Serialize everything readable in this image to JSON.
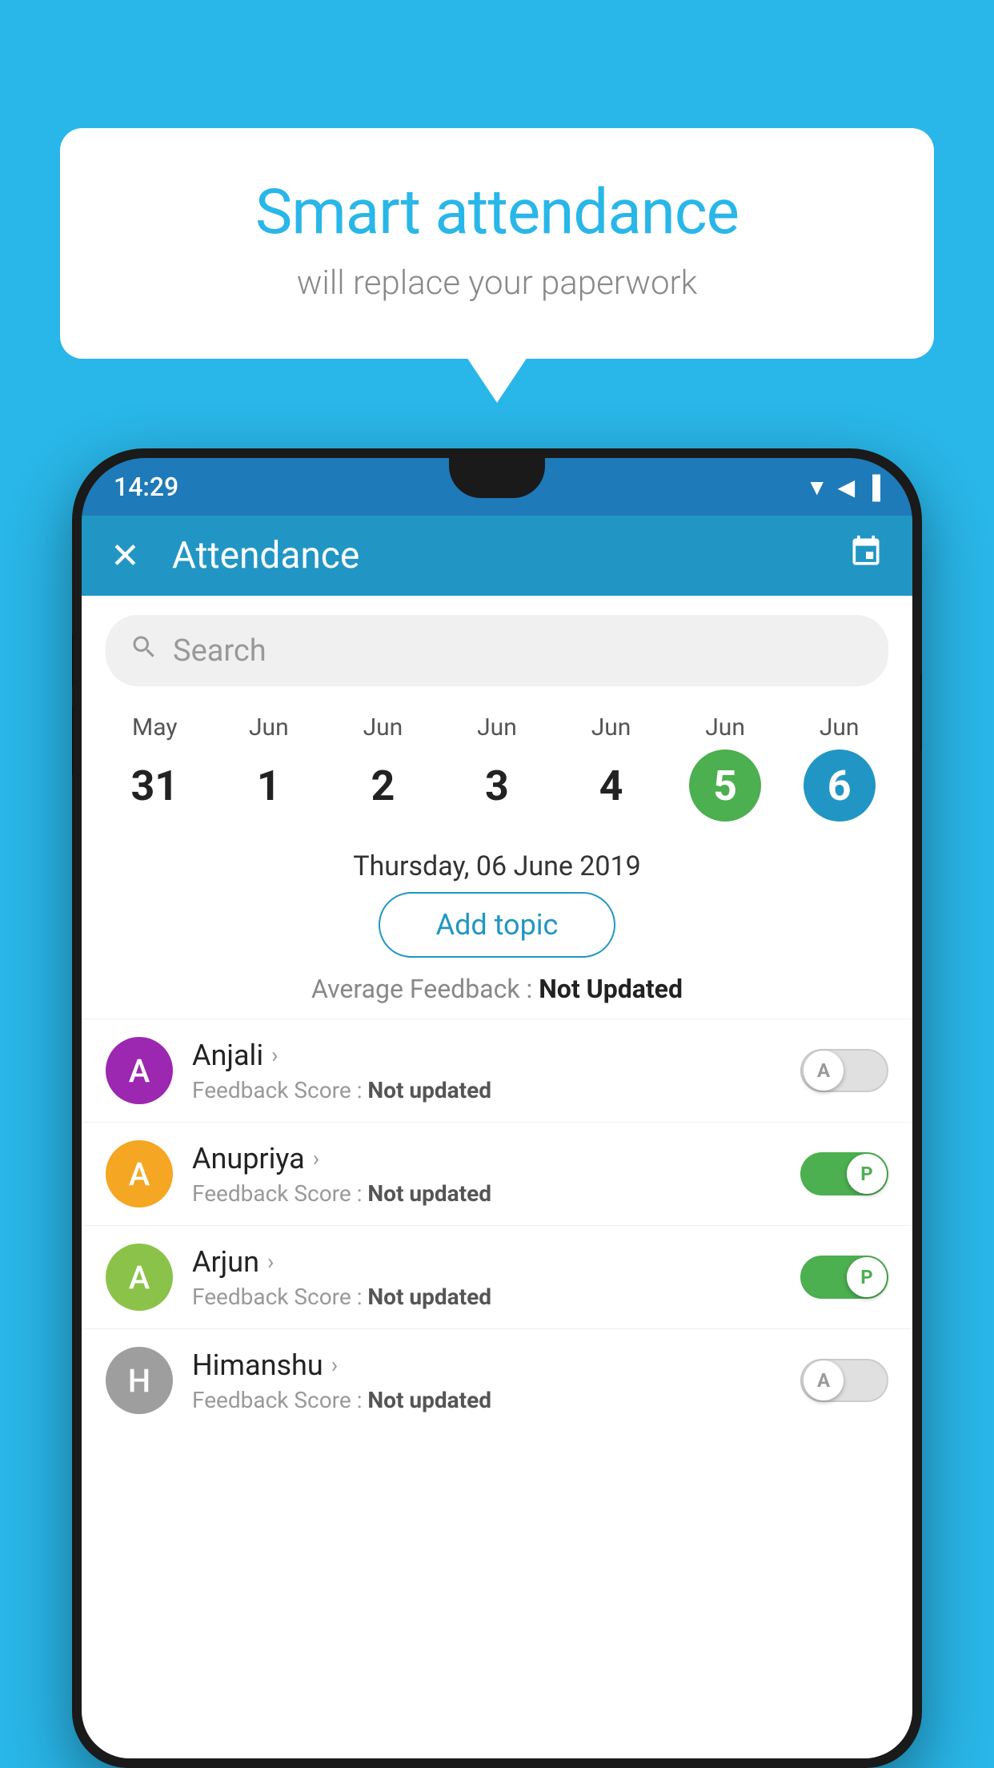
{
  "background_color": "#29b6e8",
  "bubble": {
    "title": "Smart attendance",
    "subtitle": "will replace your paperwork"
  },
  "status_bar": {
    "time": "14:29",
    "icons": "▼◀▐"
  },
  "top_bar": {
    "close_label": "✕",
    "title": "Attendance",
    "calendar_icon": "📅"
  },
  "search": {
    "placeholder": "Search"
  },
  "calendar": {
    "days": [
      {
        "month": "May",
        "date": "31",
        "state": "normal"
      },
      {
        "month": "Jun",
        "date": "1",
        "state": "normal"
      },
      {
        "month": "Jun",
        "date": "2",
        "state": "normal"
      },
      {
        "month": "Jun",
        "date": "3",
        "state": "normal"
      },
      {
        "month": "Jun",
        "date": "4",
        "state": "normal"
      },
      {
        "month": "Jun",
        "date": "5",
        "state": "today"
      },
      {
        "month": "Jun",
        "date": "6",
        "state": "selected"
      }
    ]
  },
  "selected_date_label": "Thursday, 06 June 2019",
  "add_topic_label": "Add topic",
  "avg_feedback_prefix": "Average Feedback : ",
  "avg_feedback_value": "Not Updated",
  "students": [
    {
      "name": "Anjali",
      "avatar_letter": "A",
      "avatar_color": "#9c27b0",
      "feedback_label": "Feedback Score : ",
      "feedback_value": "Not updated",
      "toggle_state": "off",
      "toggle_letter": "A"
    },
    {
      "name": "Anupriya",
      "avatar_letter": "A",
      "avatar_color": "#f5a623",
      "feedback_label": "Feedback Score : ",
      "feedback_value": "Not updated",
      "toggle_state": "on",
      "toggle_letter": "P"
    },
    {
      "name": "Arjun",
      "avatar_letter": "A",
      "avatar_color": "#8bc34a",
      "feedback_label": "Feedback Score : ",
      "feedback_value": "Not updated",
      "toggle_state": "on",
      "toggle_letter": "P"
    },
    {
      "name": "Himanshu",
      "avatar_letter": "H",
      "avatar_color": "#9e9e9e",
      "feedback_label": "Feedback Score : ",
      "feedback_value": "Not updated",
      "toggle_state": "off",
      "toggle_letter": "A"
    }
  ]
}
